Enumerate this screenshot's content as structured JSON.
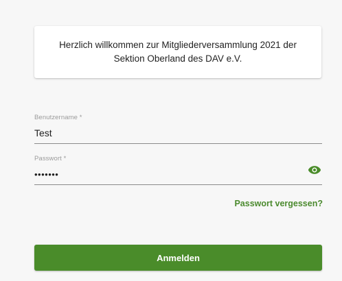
{
  "welcome": {
    "line1": "Herzlich willkommen zur Mitgliederversammlung 2021 der",
    "line2": "Sektion Oberland des DAV e.V."
  },
  "login_form": {
    "username": {
      "label": "Benutzername *",
      "value": "Test"
    },
    "password": {
      "label": "Passwort *",
      "value": "•••••••",
      "toggle_icon": "eye-icon"
    },
    "forgot_password_label": "Passwort vergessen?",
    "submit_label": "Anmelden"
  },
  "colors": {
    "accent": "#4a8c2a",
    "link": "#4b8a2e",
    "background": "#f7f7f7"
  }
}
